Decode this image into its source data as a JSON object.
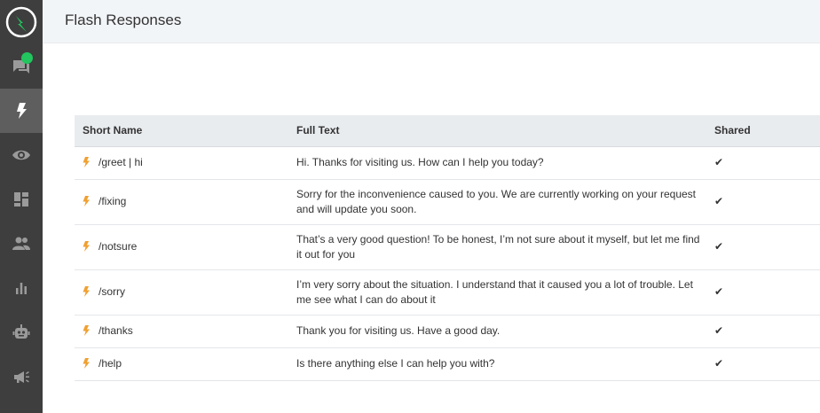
{
  "header": {
    "title": "Flash Responses"
  },
  "sidebar": {
    "items": [
      {
        "icon": "chat-icon",
        "active": false,
        "badge": true
      },
      {
        "icon": "bolt-icon",
        "active": true
      },
      {
        "icon": "eye-icon",
        "active": false
      },
      {
        "icon": "dashboard-icon",
        "active": false
      },
      {
        "icon": "people-icon",
        "active": false
      },
      {
        "icon": "bar-chart-icon",
        "active": false
      },
      {
        "icon": "bot-icon",
        "active": false
      },
      {
        "icon": "megaphone-icon",
        "active": false
      }
    ]
  },
  "colors": {
    "sidebar_bg": "#3e3e3e",
    "sidebar_active": "#5e5e5e",
    "accent_green": "#22c55e",
    "bolt_orange": "#f0a030"
  },
  "table": {
    "columns": [
      "Short Name",
      "Full Text",
      "Shared"
    ],
    "rows": [
      {
        "short_name": "/greet | hi",
        "full_text": "Hi. Thanks for visiting us. How can I help you today?",
        "shared": "✔"
      },
      {
        "short_name": "/fixing",
        "full_text": "Sorry for the inconvenience caused to you. We are currently working on your request and will update you soon.",
        "shared": "✔"
      },
      {
        "short_name": "/notsure",
        "full_text": "That’s a very good question! To be honest, I’m not sure about it myself, but let me find it out for you",
        "shared": "✔"
      },
      {
        "short_name": "/sorry",
        "full_text": "I’m very sorry about the situation. I understand that it caused you a lot of trouble. Let me see what I can do about it",
        "shared": "✔"
      },
      {
        "short_name": "/thanks",
        "full_text": "Thank you for visiting us. Have a good day.",
        "shared": "✔"
      },
      {
        "short_name": "/help",
        "full_text": "Is there anything else I can help you with?",
        "shared": "✔"
      }
    ]
  }
}
